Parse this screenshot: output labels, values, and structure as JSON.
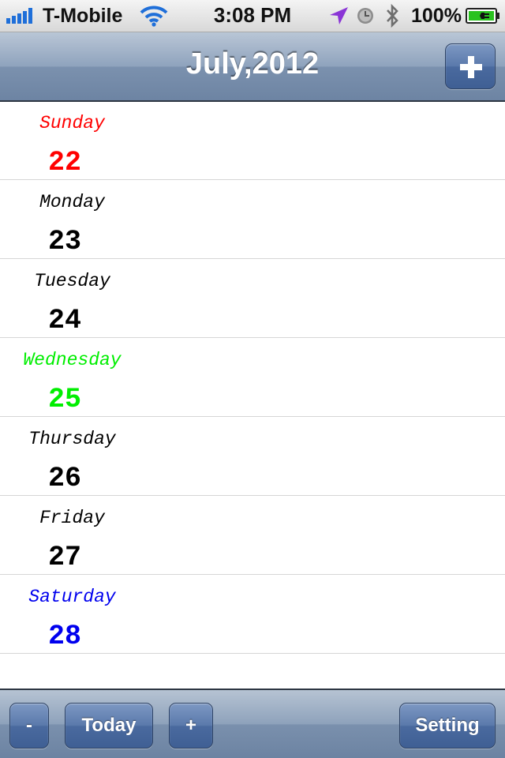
{
  "status_bar": {
    "carrier": "T-Mobile",
    "time": "3:08 PM",
    "battery_percent": "100%",
    "icons": [
      "signal-bars-icon",
      "wifi-icon",
      "location-arrow-icon",
      "alarm-clock-icon",
      "bluetooth-icon",
      "battery-charging-icon"
    ],
    "colors": {
      "signal": "#1f6fd9",
      "wifi": "#1f6fd9",
      "location": "#8a35d6",
      "battery_fill": "#29c21f"
    }
  },
  "nav": {
    "title": "July,2012",
    "add_icon": "plus-icon"
  },
  "days": [
    {
      "name": "Sunday",
      "number": "22",
      "color": "#ff0000"
    },
    {
      "name": "Monday",
      "number": "23",
      "color": "#000000"
    },
    {
      "name": "Tuesday",
      "number": "24",
      "color": "#000000"
    },
    {
      "name": "Wednesday",
      "number": "25",
      "color": "#00ee00"
    },
    {
      "name": "Thursday",
      "number": "26",
      "color": "#000000"
    },
    {
      "name": "Friday",
      "number": "27",
      "color": "#000000"
    },
    {
      "name": "Saturday",
      "number": "28",
      "color": "#0000ee"
    }
  ],
  "toolbar": {
    "minus_label": "-",
    "today_label": "Today",
    "plus_label": "+",
    "setting_label": "Setting"
  }
}
